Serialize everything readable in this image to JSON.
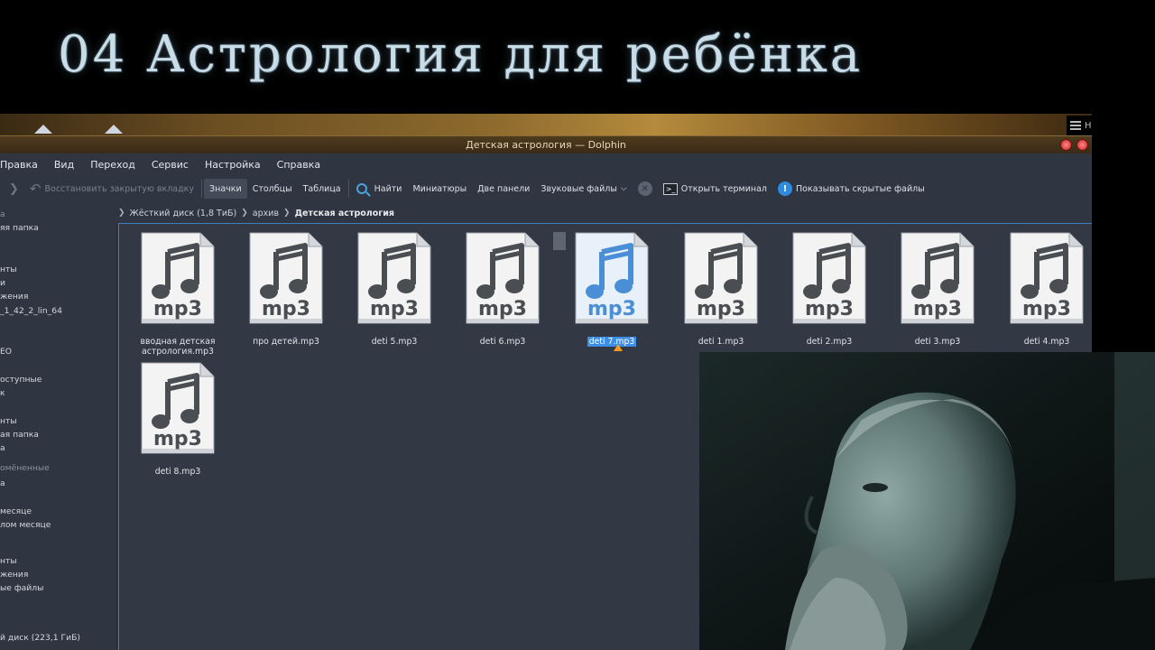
{
  "banner": {
    "title": "04 Астрология для ребёнка"
  },
  "top_right": {
    "label": "Н"
  },
  "window": {
    "title": "Детская астрология — Dolphin"
  },
  "menu": [
    "Правка",
    "Вид",
    "Переход",
    "Сервис",
    "Настройка",
    "Справка"
  ],
  "toolbar": {
    "restore_tab": "Восстановить закрытую вкладку",
    "icons_view": "Значки",
    "columns_view": "Столбцы",
    "table_view": "Таблица",
    "find": "Найти",
    "thumbnails": "Миниатюры",
    "split": "Две панели",
    "audio_files": "Звуковые файлы",
    "open_terminal": "Открыть терминал",
    "show_hidden": "Показывать скрытые файлы"
  },
  "breadcrumb": [
    "Жёсткий диск (1,8 ТиБ)",
    "архив",
    "Детская астрология"
  ],
  "sidebar": [
    "а",
    "яя папка",
    "",
    "нты",
    "и",
    "жения",
    "_1_42_2_lin_64",
    "",
    "EO",
    "",
    "оступные",
    "к",
    "",
    "нты",
    "ая папка",
    "а",
    "омёненные",
    "а",
    "",
    "месяце",
    "лом месяце",
    "",
    "",
    "нты",
    "жения",
    "ые файлы",
    "",
    "",
    "й диск (223,1 ГиБ)"
  ],
  "files": [
    {
      "name": "вводная детская астрология.mp3",
      "ext": "mp3",
      "selected": false
    },
    {
      "name": "про детей.mp3",
      "ext": "mp3",
      "selected": false
    },
    {
      "name": "deti  5.mp3",
      "ext": "mp3",
      "selected": false
    },
    {
      "name": "deti  6.mp3",
      "ext": "mp3",
      "selected": false
    },
    {
      "name": "deti  7.mp3",
      "ext": "mp3",
      "selected": true
    },
    {
      "name": "deti 1.mp3",
      "ext": "mp3",
      "selected": false
    },
    {
      "name": "deti 2.mp3",
      "ext": "mp3",
      "selected": false
    },
    {
      "name": "deti 3.mp3",
      "ext": "mp3",
      "selected": false
    },
    {
      "name": "deti 4.mp3",
      "ext": "mp3",
      "selected": false
    },
    {
      "name": "deti 8.mp3",
      "ext": "mp3",
      "selected": false
    }
  ],
  "colors": {
    "accent": "#3d8ee6",
    "window_bg": "#2f3541",
    "view_bg": "#323944"
  }
}
